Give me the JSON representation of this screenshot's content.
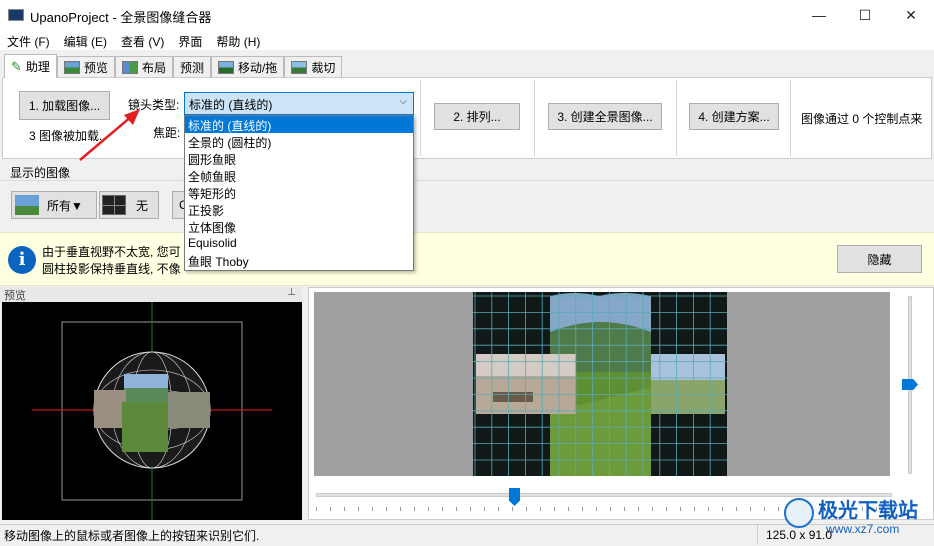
{
  "window": {
    "title": "UpanoProject - 全景图像缝合器",
    "minimize": "—",
    "maximize": "☐",
    "close": "✕"
  },
  "menu": [
    "文件 (F)",
    "编辑 (E)",
    "查看 (V)",
    "界面",
    "帮助 (H)"
  ],
  "tabs": [
    "助理",
    "预览",
    "布局",
    "预测",
    "移动/拖",
    "裁切"
  ],
  "assistant": {
    "load_images_button": "1. 加载图像...",
    "images_loaded": "3 图像被加载.",
    "lens_type_label": "镜头类型:",
    "lens_type_selected": "标准的 (直线的)",
    "focal_label": "焦距:",
    "align_button": "2. 排列...",
    "create_panorama_button": "3. 创建全景图像...",
    "create_project_button": "4. 创建方案...",
    "control_points_text": "图像通过 0 个控制点来"
  },
  "lens_options": [
    "标准的 (直线的)",
    "全景的 (圆柱的)",
    "圆形鱼眼",
    "全帧鱼眼",
    "等矩形的",
    "正投影",
    "立体图像",
    "Equisolid",
    "鱼眼 Thoby"
  ],
  "shown_images": {
    "label": "显示的图像",
    "all_button": "所有▼",
    "none_button": "无",
    "partial_visible": "C"
  },
  "info": {
    "line1": "由于垂直视野不太宽, 您可",
    "line2": "圆柱投影保持垂直线, 不像",
    "hide_button": "隐藏"
  },
  "preview_panel": {
    "title": "预览",
    "pin_icon": "pin-icon"
  },
  "status": {
    "message": "移动图像上的鼠标或者图像上的按钮来识别它们.",
    "fov": "125.0 x 91.0"
  },
  "watermark": {
    "name": "极光下载站",
    "url": "www.xz7.com"
  },
  "colors": {
    "selection": "#0078d7",
    "info_bg": "#ffffe1",
    "red_arrow": "#e02020",
    "grid": "#5aaab5"
  }
}
